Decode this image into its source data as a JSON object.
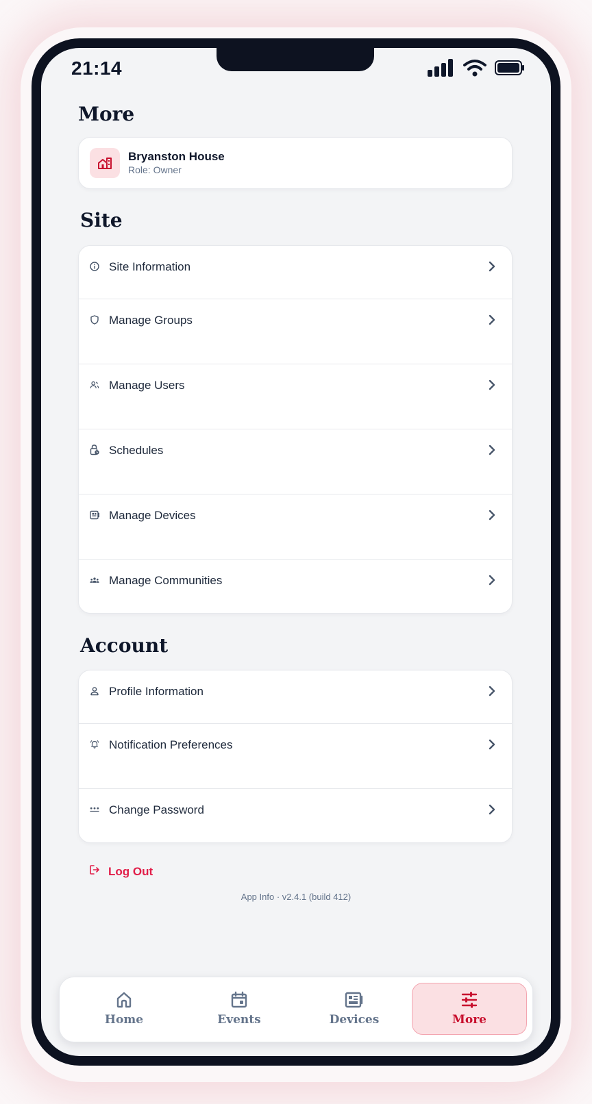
{
  "status_bar": {
    "time": "21:14"
  },
  "page": {
    "title": "More"
  },
  "site_card": {
    "name": "Bryanston House",
    "role": "Role: Owner"
  },
  "site_section": {
    "title": "Site",
    "items": [
      {
        "label": "Site Information",
        "icon": "info-icon"
      },
      {
        "label": "Manage Groups",
        "icon": "shield-icon"
      },
      {
        "label": "Manage Users",
        "icon": "users-icon"
      },
      {
        "label": "Schedules",
        "icon": "lock-clock-icon"
      },
      {
        "label": "Manage Devices",
        "icon": "device-icon"
      },
      {
        "label": "Manage Communities",
        "icon": "community-icon"
      }
    ]
  },
  "account_section": {
    "title": "Account",
    "items": [
      {
        "label": "Profile Information",
        "icon": "person-icon"
      },
      {
        "label": "Notification Preferences",
        "icon": "bell-icon"
      },
      {
        "label": "Change Password",
        "icon": "password-dots-icon"
      }
    ]
  },
  "logout": {
    "label": "Log Out"
  },
  "app_info": "App Info · v2.4.1 (build 412)",
  "tabbar": {
    "tabs": [
      {
        "label": "Home",
        "icon": "home-icon"
      },
      {
        "label": "Events",
        "icon": "calendar-icon"
      },
      {
        "label": "Devices",
        "icon": "devices-icon"
      },
      {
        "label": "More",
        "icon": "sliders-icon",
        "active": true
      }
    ]
  },
  "colors": {
    "accent": "#c8102e",
    "logout": "#e11d48",
    "text_muted": "#64748b"
  }
}
